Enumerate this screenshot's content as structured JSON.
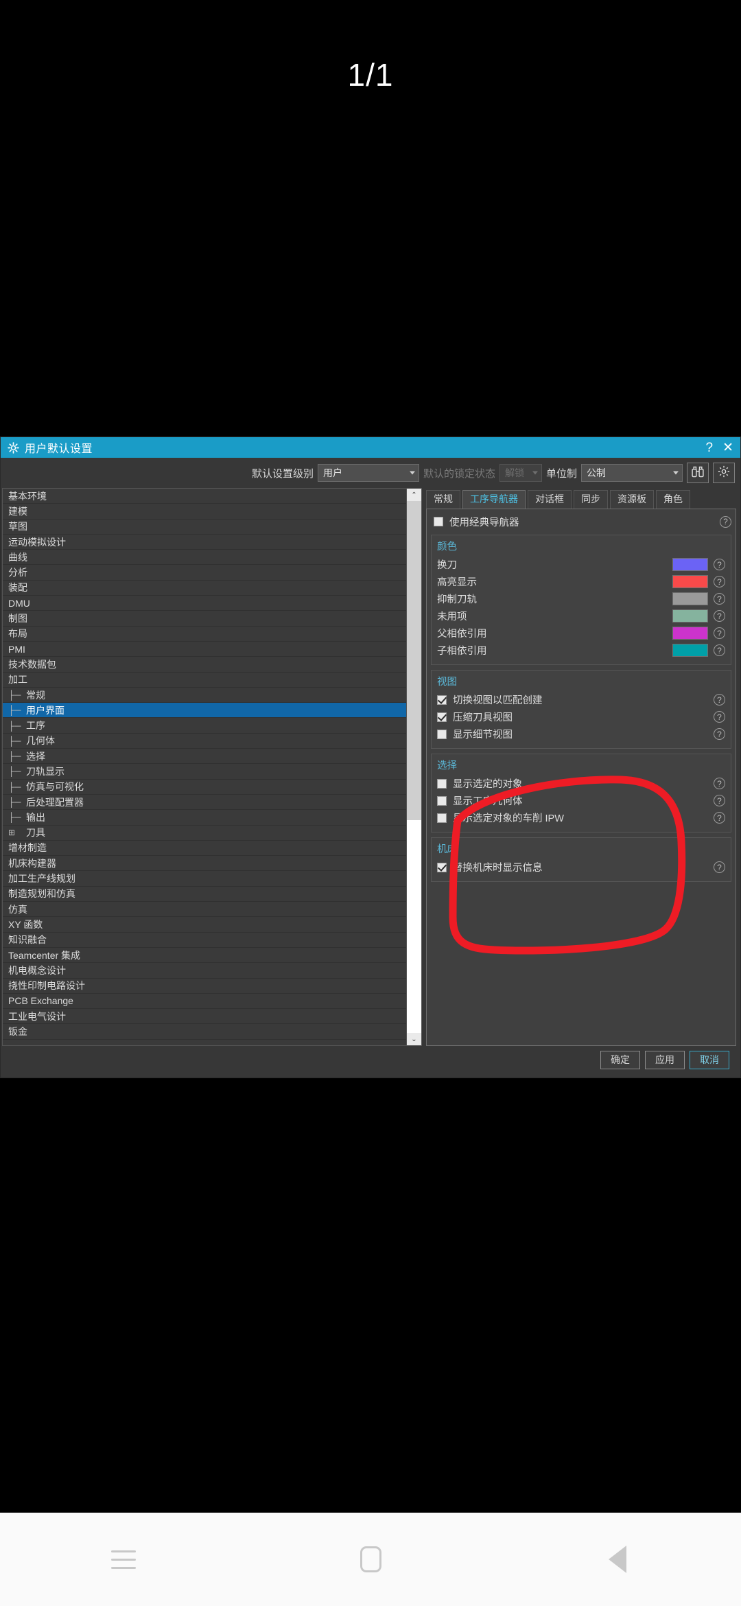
{
  "page_counter": "1/1",
  "dialog": {
    "title": "用户默认设置",
    "title_icon": "gear-icon",
    "help_btn": "?",
    "close_btn": "✕",
    "toolbar": {
      "level_label": "默认设置级别",
      "level_value": "用户",
      "lock_label": "默认的锁定状态",
      "lock_value": "解锁",
      "units_label": "单位制",
      "units_value": "公制",
      "find_icon": "binoculars-icon",
      "settings_icon": "gear-icon"
    },
    "tree": [
      {
        "label": "基本环境",
        "indent": 0,
        "marker": "",
        "selected": false
      },
      {
        "label": "建模",
        "indent": 0,
        "marker": "",
        "selected": false
      },
      {
        "label": "草图",
        "indent": 0,
        "marker": "",
        "selected": false
      },
      {
        "label": "运动模拟设计",
        "indent": 0,
        "marker": "",
        "selected": false
      },
      {
        "label": "曲线",
        "indent": 0,
        "marker": "",
        "selected": false
      },
      {
        "label": "分析",
        "indent": 0,
        "marker": "",
        "selected": false
      },
      {
        "label": "装配",
        "indent": 0,
        "marker": "",
        "selected": false
      },
      {
        "label": "DMU",
        "indent": 0,
        "marker": "",
        "selected": false
      },
      {
        "label": "制图",
        "indent": 0,
        "marker": "",
        "selected": false
      },
      {
        "label": "布局",
        "indent": 0,
        "marker": "",
        "selected": false
      },
      {
        "label": "PMI",
        "indent": 0,
        "marker": "",
        "selected": false
      },
      {
        "label": "技术数据包",
        "indent": 0,
        "marker": "",
        "selected": false
      },
      {
        "label": "加工",
        "indent": 0,
        "marker": "",
        "selected": false
      },
      {
        "label": "常规",
        "indent": 1,
        "marker": "├─",
        "selected": false
      },
      {
        "label": "用户界面",
        "indent": 1,
        "marker": "├─",
        "selected": true
      },
      {
        "label": "工序",
        "indent": 1,
        "marker": "├─",
        "selected": false
      },
      {
        "label": "几何体",
        "indent": 1,
        "marker": "├─",
        "selected": false
      },
      {
        "label": "选择",
        "indent": 1,
        "marker": "├─",
        "selected": false
      },
      {
        "label": "刀轨显示",
        "indent": 1,
        "marker": "├─",
        "selected": false
      },
      {
        "label": "仿真与可视化",
        "indent": 1,
        "marker": "├─",
        "selected": false
      },
      {
        "label": "后处理配置器",
        "indent": 1,
        "marker": "├─",
        "selected": false
      },
      {
        "label": "输出",
        "indent": 1,
        "marker": "├─",
        "selected": false
      },
      {
        "label": "刀具",
        "indent": 1,
        "marker": "⊞",
        "selected": false
      },
      {
        "label": "增材制造",
        "indent": 0,
        "marker": "",
        "selected": false
      },
      {
        "label": "机床构建器",
        "indent": 0,
        "marker": "",
        "selected": false
      },
      {
        "label": "加工生产线规划",
        "indent": 0,
        "marker": "",
        "selected": false
      },
      {
        "label": "制造规划和仿真",
        "indent": 0,
        "marker": "",
        "selected": false
      },
      {
        "label": "仿真",
        "indent": 0,
        "marker": "",
        "selected": false
      },
      {
        "label": "XY 函数",
        "indent": 0,
        "marker": "",
        "selected": false
      },
      {
        "label": "知识融合",
        "indent": 0,
        "marker": "",
        "selected": false
      },
      {
        "label": "Teamcenter 集成",
        "indent": 0,
        "marker": "",
        "selected": false
      },
      {
        "label": "机电概念设计",
        "indent": 0,
        "marker": "",
        "selected": false
      },
      {
        "label": "挠性印制电路设计",
        "indent": 0,
        "marker": "",
        "selected": false
      },
      {
        "label": "PCB Exchange",
        "indent": 0,
        "marker": "",
        "selected": false
      },
      {
        "label": "工业电气设计",
        "indent": 0,
        "marker": "",
        "selected": false
      },
      {
        "label": "钣金",
        "indent": 0,
        "marker": "",
        "selected": false
      }
    ],
    "scrollbar": {
      "up": "⌃",
      "down": "⌄"
    },
    "tabs": [
      {
        "label": "常规",
        "active": false
      },
      {
        "label": "工序导航器",
        "active": true
      },
      {
        "label": "对话框",
        "active": false
      },
      {
        "label": "同步",
        "active": false
      },
      {
        "label": "资源板",
        "active": false
      },
      {
        "label": "角色",
        "active": false
      }
    ],
    "classic_nav": {
      "label": "使用经典导航器",
      "checked": false,
      "help": "?"
    },
    "color_group": {
      "title": "颜色",
      "rows": [
        {
          "label": "换刀",
          "color": "#6b63f5",
          "help": "?"
        },
        {
          "label": "高亮显示",
          "color": "#f94a4a",
          "help": "?"
        },
        {
          "label": "抑制刀轨",
          "color": "#9a9a9a",
          "help": "?"
        },
        {
          "label": "未用项",
          "color": "#85b39e",
          "help": "?"
        },
        {
          "label": "父相依引用",
          "color": "#cc33cc",
          "help": "?"
        },
        {
          "label": "子相依引用",
          "color": "#00a0a8",
          "help": "?"
        }
      ]
    },
    "view_group": {
      "title": "视图",
      "rows": [
        {
          "label": "切换视图以匹配创建",
          "checked": true,
          "help": "?"
        },
        {
          "label": "压缩刀具视图",
          "checked": true,
          "help": "?"
        },
        {
          "label": "显示细节视图",
          "checked": false,
          "help": "?"
        }
      ]
    },
    "selection_group": {
      "title": "选择",
      "rows": [
        {
          "label": "显示选定的对象",
          "checked": false,
          "help": "?"
        },
        {
          "label": "显示工序几何体",
          "checked": false,
          "help": "?"
        },
        {
          "label": "显示选定对象的车削 IPW",
          "checked": false,
          "help": "?"
        }
      ]
    },
    "machine_group": {
      "title": "机床",
      "rows": [
        {
          "label": "替换机床时显示信息",
          "checked": true,
          "help": "?"
        }
      ]
    },
    "footer": {
      "ok": "确定",
      "apply": "应用",
      "cancel": "取消"
    }
  },
  "annotation": {
    "shape": "hand-drawn-ellipse",
    "color": "#ee1c25"
  },
  "navbar": {
    "recents": "recents-icon",
    "home": "home-icon",
    "back": "back-icon"
  }
}
